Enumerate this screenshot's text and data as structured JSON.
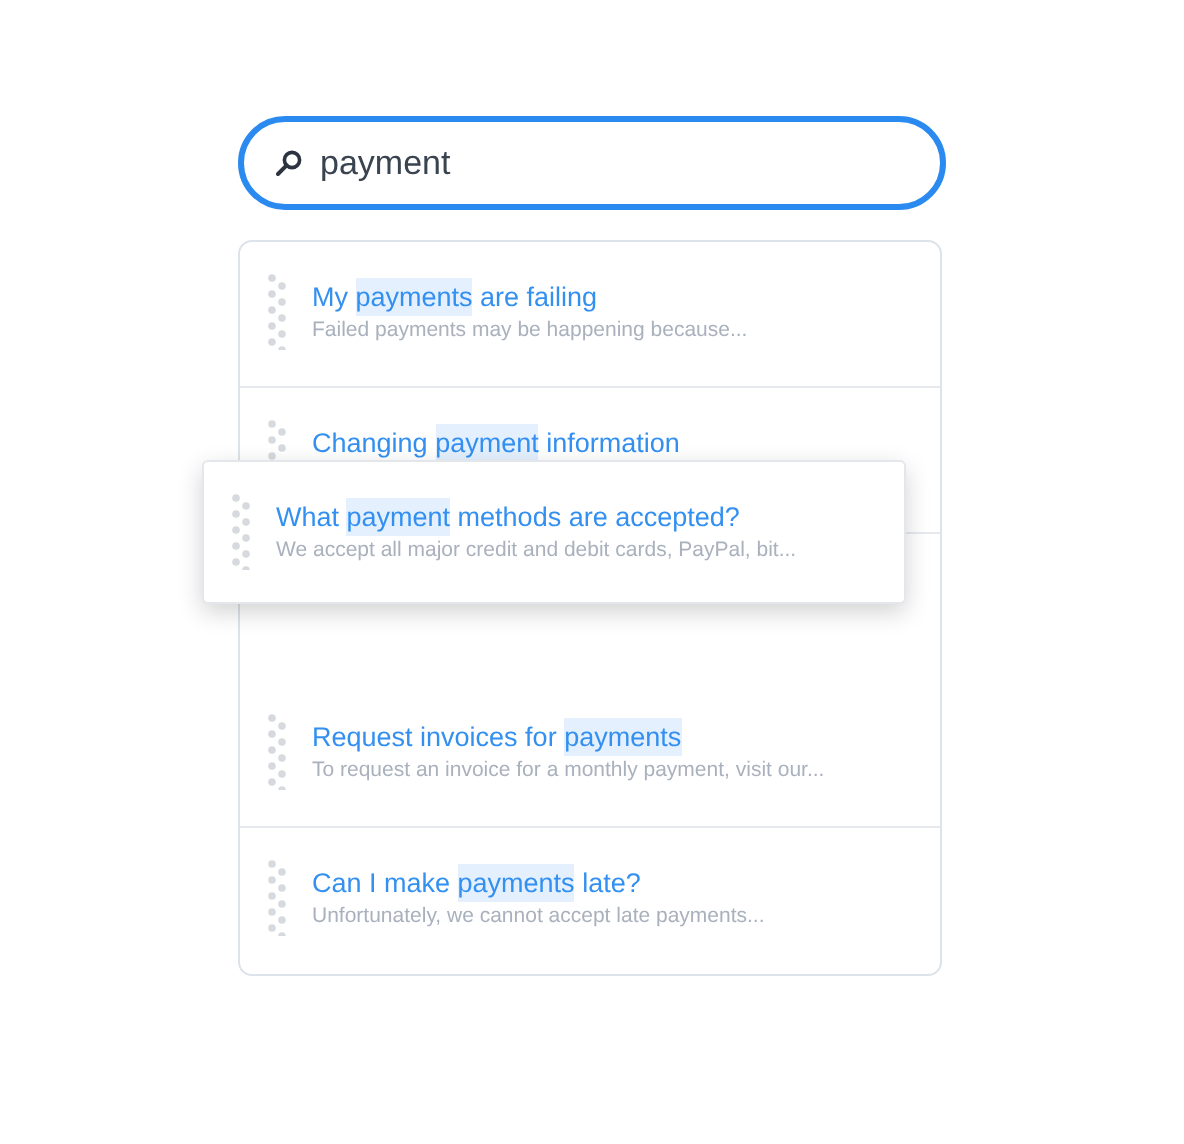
{
  "search": {
    "value": "payment"
  },
  "results": [
    {
      "kind": "item",
      "title": [
        {
          "text": "My ",
          "highlighted": false
        },
        {
          "text": "payments",
          "highlighted": true
        },
        {
          "text": " are failing",
          "highlighted": false
        }
      ],
      "snippet": "Failed payments may be happening because..."
    },
    {
      "kind": "item",
      "title": [
        {
          "text": "Changing ",
          "highlighted": false
        },
        {
          "text": "payment",
          "highlighted": true
        },
        {
          "text": " information",
          "highlighted": false
        }
      ]
    },
    {
      "kind": "drop-slot"
    },
    {
      "kind": "item",
      "title": [
        {
          "text": "Request invoices for ",
          "highlighted": false
        },
        {
          "text": "payments",
          "highlighted": true
        }
      ],
      "snippet": "To request an invoice for a monthly payment, visit our..."
    },
    {
      "kind": "item",
      "title": [
        {
          "text": "Can I make ",
          "highlighted": false
        },
        {
          "text": "payments",
          "highlighted": true
        },
        {
          "text": " late?",
          "highlighted": false
        }
      ],
      "snippet": "Unfortunately, we cannot accept late payments..."
    }
  ],
  "dragged_item": {
    "title": [
      {
        "text": "What ",
        "highlighted": false
      },
      {
        "text": "payment",
        "highlighted": true
      },
      {
        "text": " methods are accepted?",
        "highlighted": false
      }
    ],
    "snippet": "We accept all major credit and debit cards, PayPal, bit..."
  }
}
